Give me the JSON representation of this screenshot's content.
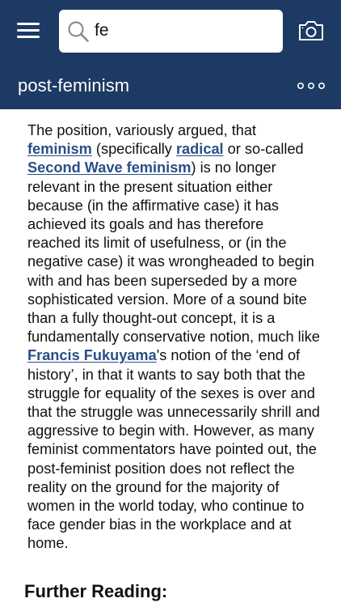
{
  "header": {
    "search": {
      "value": "fe",
      "placeholder": ""
    },
    "title": "post-feminism"
  },
  "article": {
    "segments": [
      {
        "text": "The position, variously argued, that "
      },
      {
        "text": "feminism",
        "link": true
      },
      {
        "text": " (specifically "
      },
      {
        "text": "radical",
        "link": true
      },
      {
        "text": " or so-called "
      },
      {
        "text": "Second Wave feminism",
        "link": true
      },
      {
        "text": ") is no longer relevant in the present situation either because (in the affirmative case) it has achieved its goals and has therefore reached its limit of usefulness, or (in the negative case) it was wrongheaded to begin with and has been superseded by a more sophisticated version. More of a sound bite than a fully thought-out concept, it is a fundamentally conservative notion, much like "
      },
      {
        "text": "Francis Fukuyama",
        "link": true
      },
      {
        "text": "'s notion of the ‘end of history’, in that it wants to say both that the struggle for equality of the sexes is over and that the struggle was unnecessarily shrill and aggressive to begin with. However, as many feminist commentators have pointed out, the post-feminist position does not reflect the reality on the ground for the majority of women in the world today, who continue to face gender bias in the workplace and at home."
      }
    ],
    "further_reading_heading": "Further Reading:"
  },
  "colors": {
    "header_background": "#1c3a63",
    "link": "#2a4f86",
    "text": "#111111"
  },
  "icons": [
    "menu-icon",
    "search-icon",
    "camera-icon",
    "more-icon"
  ]
}
